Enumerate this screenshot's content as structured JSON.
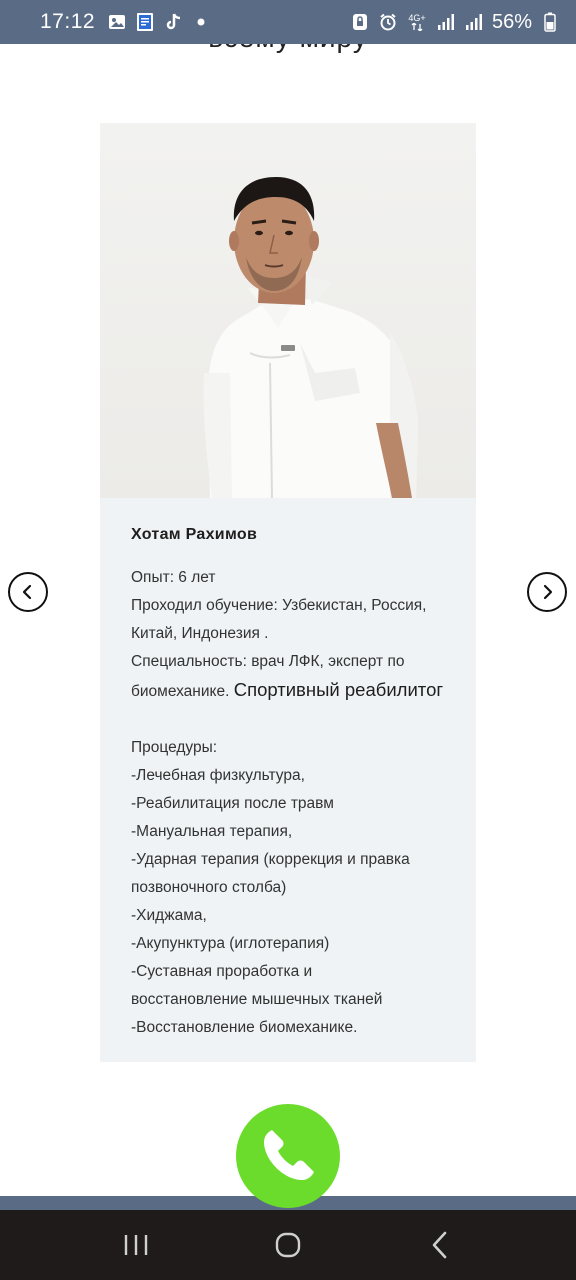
{
  "status_bar": {
    "time": "17:12",
    "network_label_top": "4G+",
    "battery": "56%",
    "icons": [
      "gallery-icon",
      "document-icon",
      "tiktok-icon",
      "dot-icon",
      "vpn-icon",
      "alarm-icon",
      "signal-icon",
      "signal-icon",
      "battery-icon"
    ]
  },
  "page": {
    "top_text": "всему миру"
  },
  "doctor": {
    "name": "Хотам Рахимов",
    "experience": "Опыт: 6 лет",
    "education_line1": "Проходил обучение: Узбекистан, Россия,",
    "education_line2": "Китай, Индонезия .",
    "specialty_line1": "Специальность: врач ЛФК, эксперт по",
    "specialty_line2_part1": "биомеханике.",
    "specialty_line2_part2": "Спортивный реабилитог",
    "procedures_title": "Процедуры:",
    "procedures": [
      "-Лечебная физкультура,",
      "-Реабилитация после травм",
      "-Мануальная терапия,",
      "-Ударная терапия (коррекция и правка",
      "позвоночного столба)",
      "-Хиджама,",
      "-Акупунктура (иглотерапия)",
      "-Суставная проработка и",
      "восстановление мышечных тканей",
      "-Восстановление биомеханике."
    ]
  },
  "colors": {
    "status_bar": "#5a6b85",
    "card_bg": "#eff3f6",
    "call_button": "#6bdb2c",
    "nav_bar": "#1f1b1b"
  }
}
